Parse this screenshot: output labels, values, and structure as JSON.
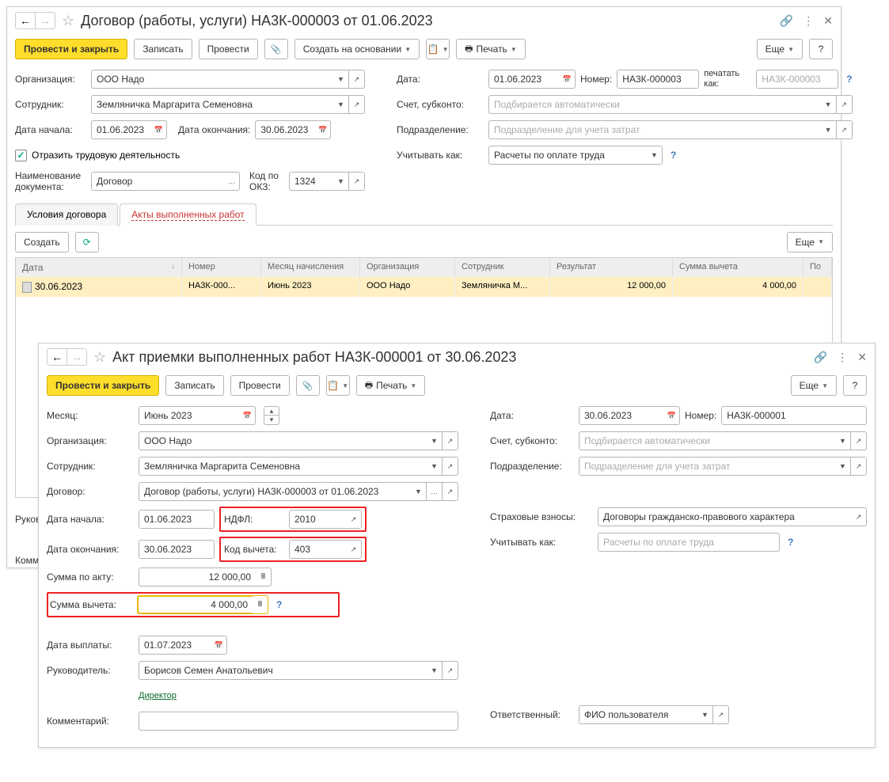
{
  "w1": {
    "title": "Договор (работы, услуги) НА3К-000003 от 01.06.2023",
    "btn_post_close": "Провести и закрыть",
    "btn_save": "Записать",
    "btn_post": "Провести",
    "btn_create_based": "Создать на основании",
    "btn_print": "Печать",
    "btn_more": "Еще",
    "lbl_org": "Организация:",
    "val_org": "ООО Надо",
    "lbl_emp": "Сотрудник:",
    "val_emp": "Земляничка Маргарита Семеновна",
    "lbl_date_start": "Дата начала:",
    "val_date_start": "01.06.2023",
    "lbl_date_end": "Дата окончания:",
    "val_date_end": "30.06.2023",
    "chk_label": "Отразить трудовую деятельность",
    "lbl_doc_name": "Наименование документа:",
    "val_doc_name": "Договор",
    "lbl_okz": "Код по ОКЗ:",
    "val_okz": "1324",
    "lbl_date": "Дата:",
    "val_date": "01.06.2023",
    "lbl_number": "Номер:",
    "val_number": "НА3К-000003",
    "lbl_print_as": "печатать как:",
    "ph_print_as": "НА3К-000003",
    "lbl_account": "Счет, субконто:",
    "ph_account": "Подбирается автоматически",
    "lbl_dept": "Подразделение:",
    "ph_dept": "Подразделение для учета затрат",
    "lbl_count_as": "Учитывать как:",
    "val_count_as": "Расчеты по оплате труда",
    "tab1": "Условия договора",
    "tab2": "Акты выполненных работ",
    "btn_create": "Создать",
    "tbl": {
      "h_date": "Дата",
      "h_number": "Номер",
      "h_month": "Месяц начисления",
      "h_org": "Организация",
      "h_emp": "Сотрудник",
      "h_result": "Результат",
      "h_deduction": "Сумма вычета",
      "h_po": "По",
      "r_date": "30.06.2023",
      "r_number": "НА3К-000...",
      "r_month": "Июнь 2023",
      "r_org": "ООО Надо",
      "r_emp": "Земляничка М...",
      "r_result": "12 000,00",
      "r_deduction": "4 000,00"
    },
    "lbl_supervisor": "Руково",
    "lbl_comment": "Коммен"
  },
  "w2": {
    "title": "Акт приемки выполненных работ НА3К-000001 от 30.06.2023",
    "btn_post_close": "Провести и закрыть",
    "btn_save": "Записать",
    "btn_post": "Провести",
    "btn_print": "Печать",
    "btn_more": "Еще",
    "lbl_month": "Месяц:",
    "val_month": "Июнь 2023",
    "lbl_org": "Организация:",
    "val_org": "ООО Надо",
    "lbl_emp": "Сотрудник:",
    "val_emp": "Земляничка Маргарита Семеновна",
    "lbl_contract": "Договор:",
    "val_contract": "Договор (работы, услуги) НА3К-000003 от 01.06.2023",
    "lbl_date_start": "Дата начала:",
    "val_date_start": "01.06.2023",
    "lbl_date_end": "Дата окончания:",
    "val_date_end": "30.06.2023",
    "lbl_ndfl": "НДФЛ:",
    "val_ndfl": "2010",
    "lbl_deduct_code": "Код вычета:",
    "val_deduct_code": "403",
    "lbl_act_sum": "Сумма по акту:",
    "val_act_sum": "12 000,00",
    "lbl_deduct_sum": "Сумма вычета:",
    "val_deduct_sum": "4 000,00",
    "lbl_pay_date": "Дата выплаты:",
    "val_pay_date": "01.07.2023",
    "lbl_supervisor": "Руководитель:",
    "val_supervisor": "Борисов Семен Анатольевич",
    "link_director": "Директор",
    "lbl_comment": "Комментарий:",
    "lbl_date": "Дата:",
    "val_date": "30.06.2023",
    "lbl_number": "Номер:",
    "val_number": "НА3К-000001",
    "lbl_account": "Счет, субконто:",
    "ph_account": "Подбирается автоматически",
    "lbl_dept": "Подразделение:",
    "ph_dept": "Подразделение для учета затрат",
    "lbl_insurance": "Страховые взносы:",
    "val_insurance": "Договоры гражданско-правового характера",
    "lbl_count_as": "Учитывать как:",
    "ph_count_as": "Расчеты по оплате труда",
    "lbl_responsible": "Ответственный:",
    "val_responsible": "ФИО пользователя"
  }
}
